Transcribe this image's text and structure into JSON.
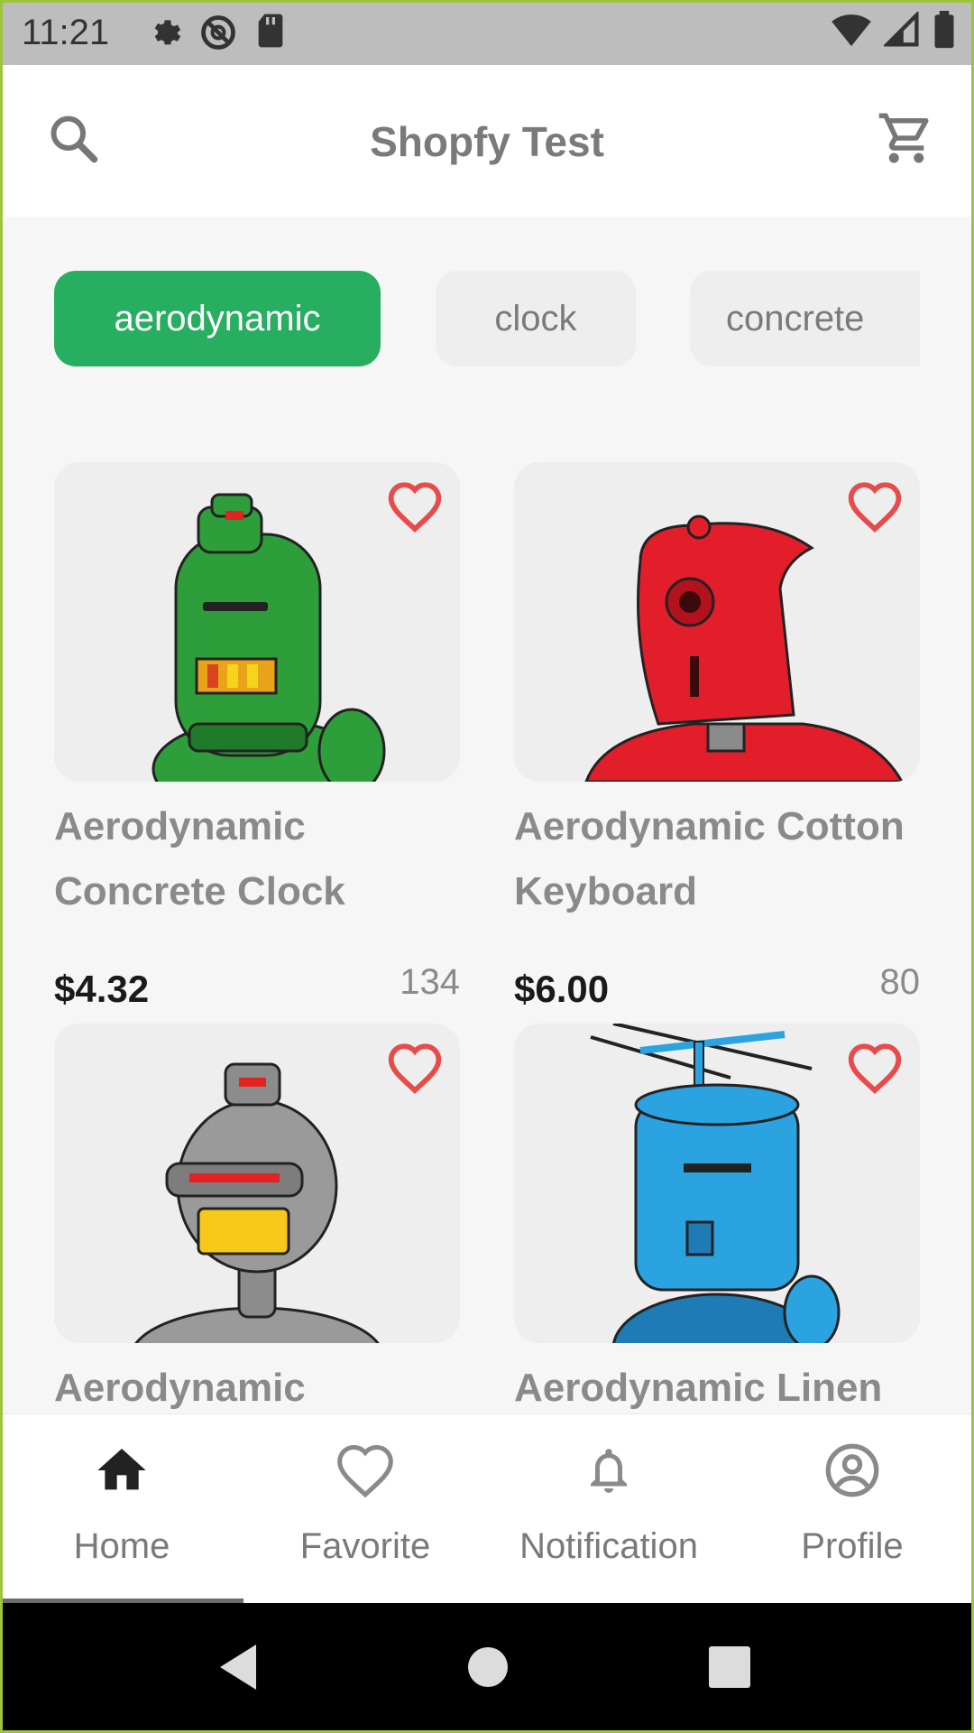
{
  "status_bar": {
    "time": "11:21",
    "icons": [
      "settings-icon",
      "no-disturb-icon",
      "sd-card-icon",
      "wifi-icon",
      "signal-icon",
      "battery-icon"
    ]
  },
  "app_bar": {
    "title": "Shopfy Test",
    "icons": [
      "search-icon",
      "cart-icon"
    ]
  },
  "chips": [
    {
      "label": "aerodynamic",
      "active": true
    },
    {
      "label": "clock",
      "active": false
    },
    {
      "label": "concrete",
      "active": false
    }
  ],
  "products": [
    {
      "name": "Aerodynamic Concrete Clock",
      "price": "$4.32",
      "count": "134",
      "robot_color": "#2e9e3a"
    },
    {
      "name": "Aerodynamic Cotton Keyboard",
      "price": "$6.00",
      "count": "80",
      "robot_color": "#e31e2b"
    },
    {
      "name": "Aerodynamic",
      "price": "",
      "count": "",
      "robot_color": "#9a9a9a"
    },
    {
      "name": "Aerodynamic Linen",
      "price": "",
      "count": "",
      "robot_color": "#2ba3e0"
    }
  ],
  "bottom_nav": [
    {
      "label": "Home",
      "icon": "home-icon",
      "active": true
    },
    {
      "label": "Favorite",
      "icon": "heart-icon",
      "active": false
    },
    {
      "label": "Notification",
      "icon": "bell-icon",
      "active": false
    },
    {
      "label": "Profile",
      "icon": "profile-icon",
      "active": false
    }
  ],
  "colors": {
    "accent": "#27ae60",
    "heart": "#e74c4c",
    "status_bar": "#bdbdbd"
  }
}
